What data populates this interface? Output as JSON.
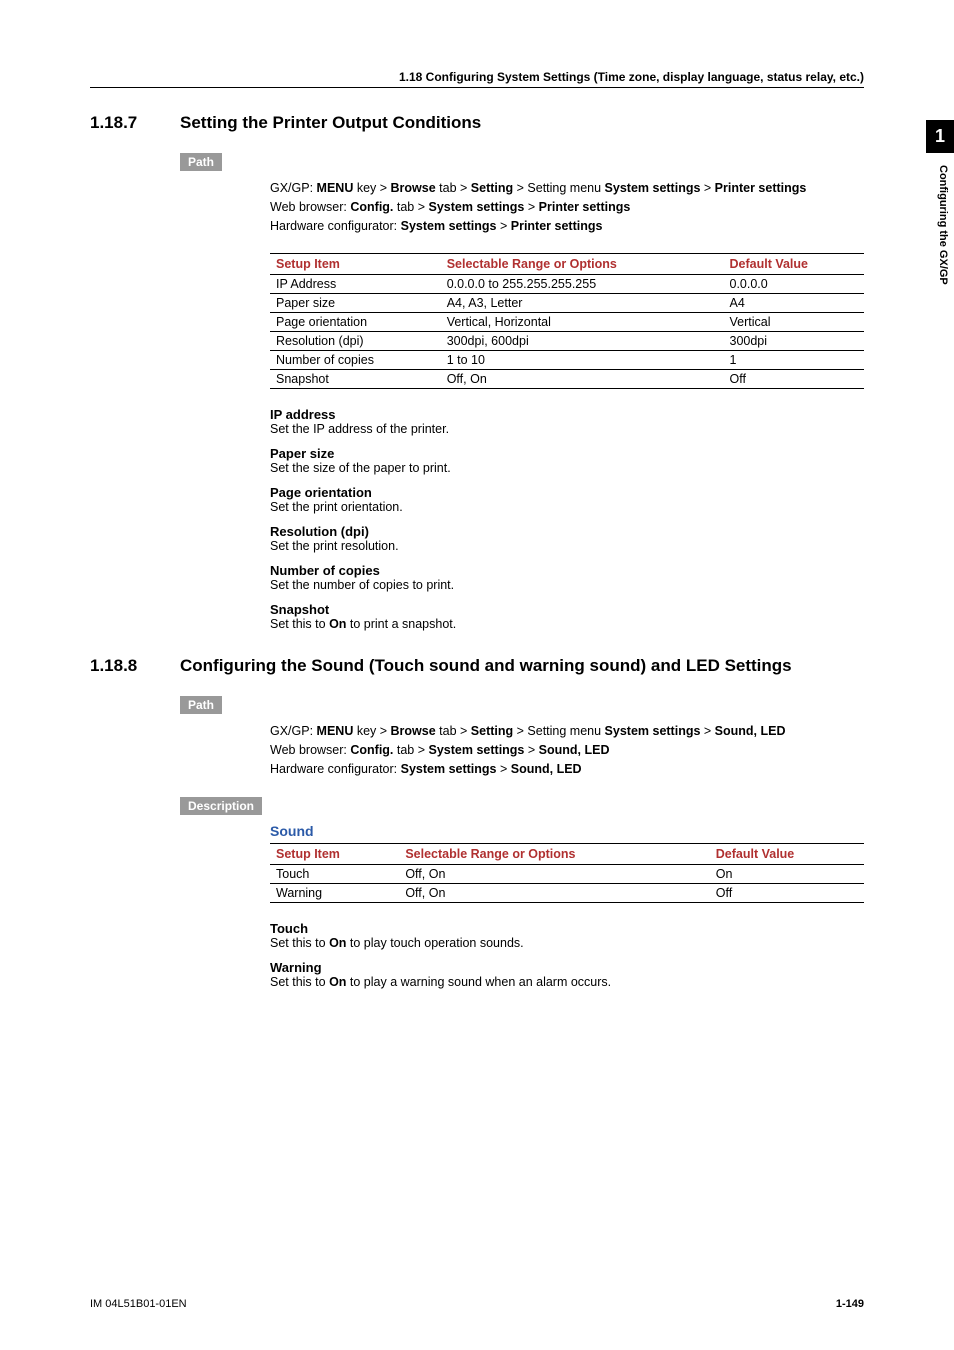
{
  "running_head": "1.18  Configuring System Settings (Time zone, display language, status relay, etc.)",
  "side_tab_num": "1",
  "side_label": "Configuring the GX/GP",
  "sec1": {
    "num": "1.18.7",
    "title": "Setting the Printer Output Conditions",
    "path_label": "Path",
    "path": {
      "l1_pre": "GX/GP: ",
      "l1_b1": "MENU",
      "l1_t1": " key > ",
      "l1_b2": "Browse",
      "l1_t2": " tab > ",
      "l1_b3": "Setting",
      "l1_t3": " > Setting menu ",
      "l1_b4": "System settings",
      "l1_t4": " > ",
      "l1_b5": "Printer settings",
      "l2_pre": "Web browser: ",
      "l2_b1": "Config.",
      "l2_t1": " tab > ",
      "l2_b2": "System settings",
      "l2_t2": " > ",
      "l2_b3": "Printer settings",
      "l3_pre": "Hardware configurator: ",
      "l3_b1": "System settings",
      "l3_t1": " > ",
      "l3_b2": "Printer settings"
    },
    "table": {
      "h1": "Setup Item",
      "h2": "Selectable Range or Options",
      "h3": "Default Value",
      "rows": [
        {
          "c1": "IP Address",
          "c2": "0.0.0.0 to 255.255.255.255",
          "c3": "0.0.0.0"
        },
        {
          "c1": "Paper size",
          "c2": "A4, A3, Letter",
          "c3": "A4"
        },
        {
          "c1": "Page orientation",
          "c2": "Vertical, Horizontal",
          "c3": "Vertical"
        },
        {
          "c1": "Resolution (dpi)",
          "c2": "300dpi, 600dpi",
          "c3": "300dpi"
        },
        {
          "c1": "Number of copies",
          "c2": "1 to 10",
          "c3": "1"
        },
        {
          "c1": "Snapshot",
          "c2": "Off, On",
          "c3": "Off"
        }
      ]
    },
    "params": [
      {
        "t": "IP address",
        "d_pre": "Set the IP address of the printer.",
        "d_b": "",
        "d_post": ""
      },
      {
        "t": "Paper size",
        "d_pre": "Set the size of the paper to print.",
        "d_b": "",
        "d_post": ""
      },
      {
        "t": "Page orientation",
        "d_pre": "Set the print orientation.",
        "d_b": "",
        "d_post": ""
      },
      {
        "t": "Resolution (dpi)",
        "d_pre": "Set the print resolution.",
        "d_b": "",
        "d_post": ""
      },
      {
        "t": "Number of copies",
        "d_pre": "Set the number of copies to print.",
        "d_b": "",
        "d_post": ""
      },
      {
        "t": "Snapshot",
        "d_pre": "Set this to ",
        "d_b": "On",
        "d_post": " to print a snapshot."
      }
    ]
  },
  "sec2": {
    "num": "1.18.8",
    "title": "Configuring the Sound (Touch sound and warning sound) and LED Settings",
    "path_label": "Path",
    "path": {
      "l1_pre": "GX/GP: ",
      "l1_b1": "MENU",
      "l1_t1": " key > ",
      "l1_b2": "Browse",
      "l1_t2": " tab > ",
      "l1_b3": "Setting",
      "l1_t3": " > Setting menu ",
      "l1_b4": "System settings",
      "l1_t4": " > ",
      "l1_b5": "Sound, LED",
      "l2_pre": "Web browser: ",
      "l2_b1": "Config.",
      "l2_t1": " tab > ",
      "l2_b2": "System settings",
      "l2_t2": " > ",
      "l2_b3": "Sound, LED",
      "l3_pre": "Hardware configurator: ",
      "l3_b1": "System settings",
      "l3_t1": " > ",
      "l3_b2": "Sound, LED"
    },
    "desc_label": "Description",
    "group": "Sound",
    "table": {
      "h1": "Setup Item",
      "h2": "Selectable Range or Options",
      "h3": "Default Value",
      "rows": [
        {
          "c1": "Touch",
          "c2": "Off, On",
          "c3": "On"
        },
        {
          "c1": "Warning",
          "c2": "Off, On",
          "c3": "Off"
        }
      ]
    },
    "params": [
      {
        "t": "Touch",
        "d_pre": "Set this to ",
        "d_b": "On",
        "d_post": " to play touch operation sounds."
      },
      {
        "t": "Warning",
        "d_pre": "Set this to ",
        "d_b": "On",
        "d_post": " to play a warning sound when an alarm occurs."
      }
    ]
  },
  "footer_left": "IM 04L51B01-01EN",
  "footer_right": "1-149"
}
